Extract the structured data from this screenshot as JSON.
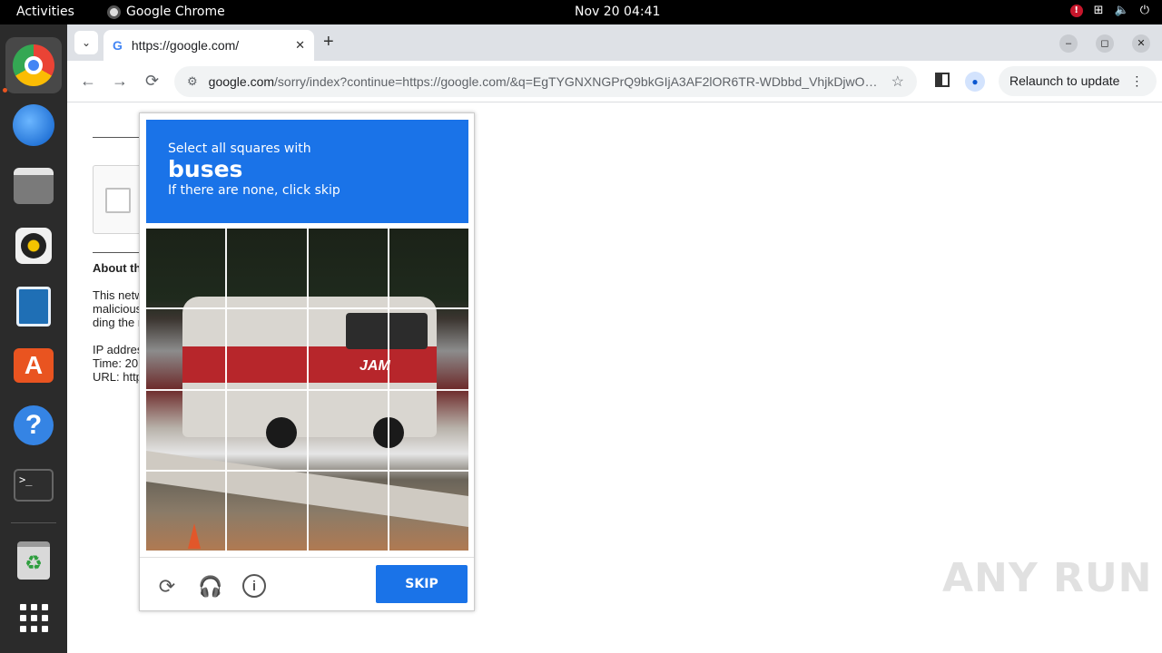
{
  "topbar": {
    "activities": "Activities",
    "app_name": "Google Chrome",
    "clock": "Nov 20  04:41",
    "alert": "!"
  },
  "dock": {
    "terminal_glyph": ">_",
    "items": [
      "chrome-icon",
      "thunderbird-icon",
      "files-icon",
      "rhythmbox-icon",
      "writer-icon",
      "app-center-icon",
      "help-icon",
      "terminal-icon",
      "trash-icon",
      "show-apps-icon"
    ]
  },
  "browser": {
    "tab_menu": "⌄",
    "tab_favicon": "G",
    "tab_title": "https://google.com/",
    "tab_close": "✕",
    "new_tab": "+",
    "address_host": "google.com",
    "address_path": "/sorry/index?continue=https://google.com/&q=EgTYGNXNGPrQ9bkGIjA3AF2lOR6TR-WDbbd_VhjkDjwO…",
    "relaunch_label": "Relaunch to update",
    "relaunch_menu": "⋮",
    "back": "←",
    "forward": "→",
    "reload": "⟳",
    "star": "☆",
    "profile": "●",
    "minimize": "–",
    "restore": "◻",
    "close": "✕"
  },
  "page": {
    "about_heading": "About th",
    "para1_line1": "This netw",
    "para1_line2": "malicious",
    "para1_line3": "ding the r",
    "para2_line1": "IP addres",
    "para2_line2": "Time: 20",
    "para2_line3": "URL: http"
  },
  "captcha": {
    "instruction": "Select all squares with",
    "target": "buses",
    "hint": "If there are none, click skip",
    "bus_logo": "JAM",
    "reload_icon": "⟳",
    "audio_icon": "🎧",
    "info_icon": "i",
    "skip_label": "SKIP"
  },
  "watermark": "ANY RUN",
  "colors": {
    "accent": "#1a73e8",
    "ubuntu_orange": "#e95420",
    "topbar": "#000000",
    "dock": "#2b2b2b"
  }
}
